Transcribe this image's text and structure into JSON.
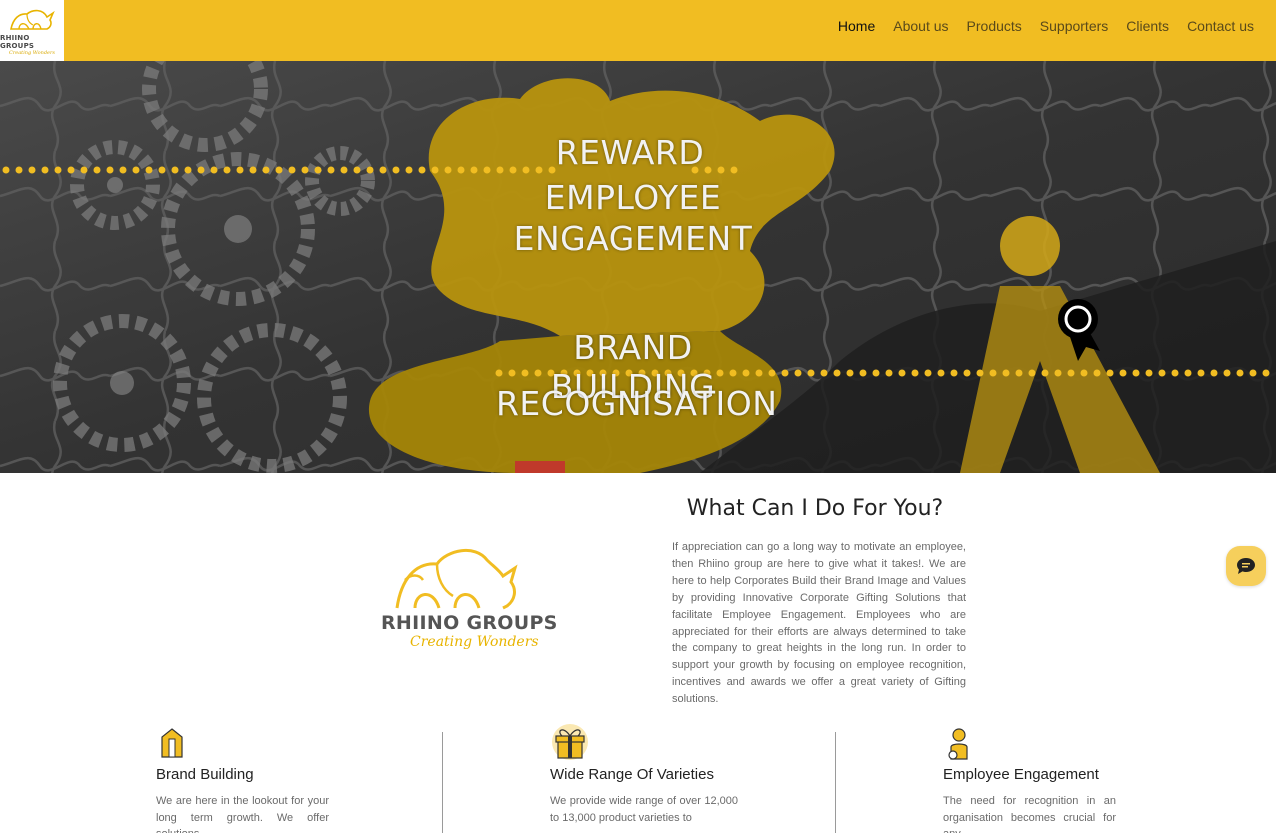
{
  "brand": {
    "name": "RHIINO GROUPS",
    "tagline": "Creating Wonders",
    "accent": "#f1bd22"
  },
  "nav": {
    "items": [
      {
        "label": "Home",
        "active": true
      },
      {
        "label": "About us",
        "active": false
      },
      {
        "label": "Products",
        "active": false
      },
      {
        "label": "Supporters",
        "active": false
      },
      {
        "label": "Clients",
        "active": false
      },
      {
        "label": "Contact us",
        "active": false
      }
    ]
  },
  "hero": {
    "line1": "REWARD",
    "line2": "EMPLOYEE",
    "line3": "ENGAGEMENT",
    "line4": "BRAND BUILDING",
    "line5": "RECOGNISATION"
  },
  "intro": {
    "title": "What Can I Do For You?",
    "body": "If appreciation can go a long way to motivate an employee, then Rhiino group are here to give what it takes!. We are here to help Corporates Build their Brand Image and Values by providing Innovative Corporate Gifting Solutions that facilitate Employee Engagement. Employees who are appreciated for their efforts are always determined to take the company to great heights in the long run. In order to support your growth by focusing on employee recognition, incentives and awards we offer a great variety of Gifting solutions."
  },
  "features": [
    {
      "icon": "building-icon",
      "title": "Brand Building",
      "body": "We are here in the lookout for your long term growth. We offer solutions"
    },
    {
      "icon": "gift-box-icon",
      "title": "Wide Range Of Varieties",
      "body": "We provide wide range of over 12,000 to 13,000 product varieties to"
    },
    {
      "icon": "employee-icon",
      "title": "Employee Engagement",
      "body": "The need for recognition in an organisation becomes crucial for any"
    }
  ],
  "chat": {
    "icon": "chat-icon"
  }
}
